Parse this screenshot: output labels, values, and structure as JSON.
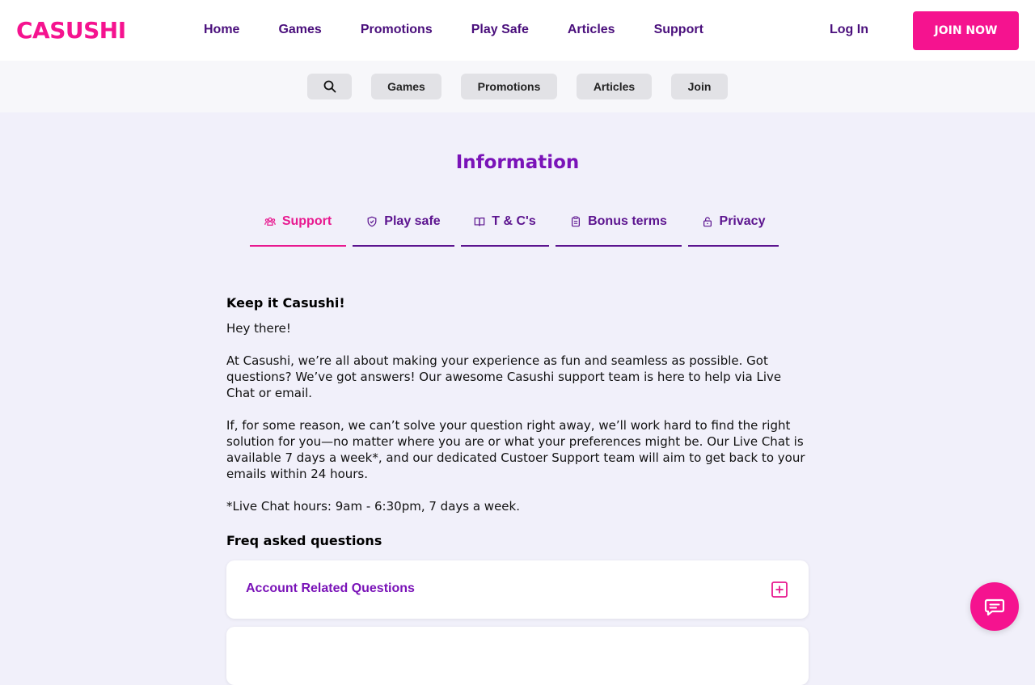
{
  "brand": {
    "logo_text": "CASUSHI",
    "accent": "#f5138f",
    "purple": "#7a13b8"
  },
  "nav": {
    "items": [
      "Home",
      "Games",
      "Promotions",
      "Play Safe",
      "Articles",
      "Support"
    ],
    "login": "Log In",
    "join": "JOIN NOW"
  },
  "subnav": {
    "search_icon": "search-icon",
    "items": [
      "Games",
      "Promotions",
      "Articles",
      "Join"
    ]
  },
  "page": {
    "title": "Information"
  },
  "tabs": [
    {
      "label": "Support",
      "icon": "users-icon",
      "active": true
    },
    {
      "label": "Play safe",
      "icon": "shield-icon",
      "active": false
    },
    {
      "label": "T & C's",
      "icon": "book-icon",
      "active": false
    },
    {
      "label": "Bonus terms",
      "icon": "clipboard-icon",
      "active": false
    },
    {
      "label": "Privacy",
      "icon": "lock-icon",
      "active": false
    }
  ],
  "content": {
    "heading": "Keep it Casushi!",
    "greeting": "Hey there!",
    "p1": "At Casushi, we’re all about making your experience as fun and seamless as possible. Got questions? We’ve got answers! Our awesome Casushi support team is here to help via Live Chat or email.",
    "p2": "If, for some reason, we can’t solve your question right away, we’ll work hard to find the right solution for you—no matter where you are or what your preferences might be. Our Live Chat is available 7 days a week*, and our dedicated Custoer Support team will aim to get back to your emails within 24 hours.",
    "hours": "*Live Chat hours: 9am - 6:30pm, 7 days a week.",
    "faq_heading": "Freq asked questions"
  },
  "faq": [
    {
      "question": "Account Related Questions"
    },
    {
      "question": ""
    }
  ],
  "chat": {
    "icon": "chat-icon"
  }
}
